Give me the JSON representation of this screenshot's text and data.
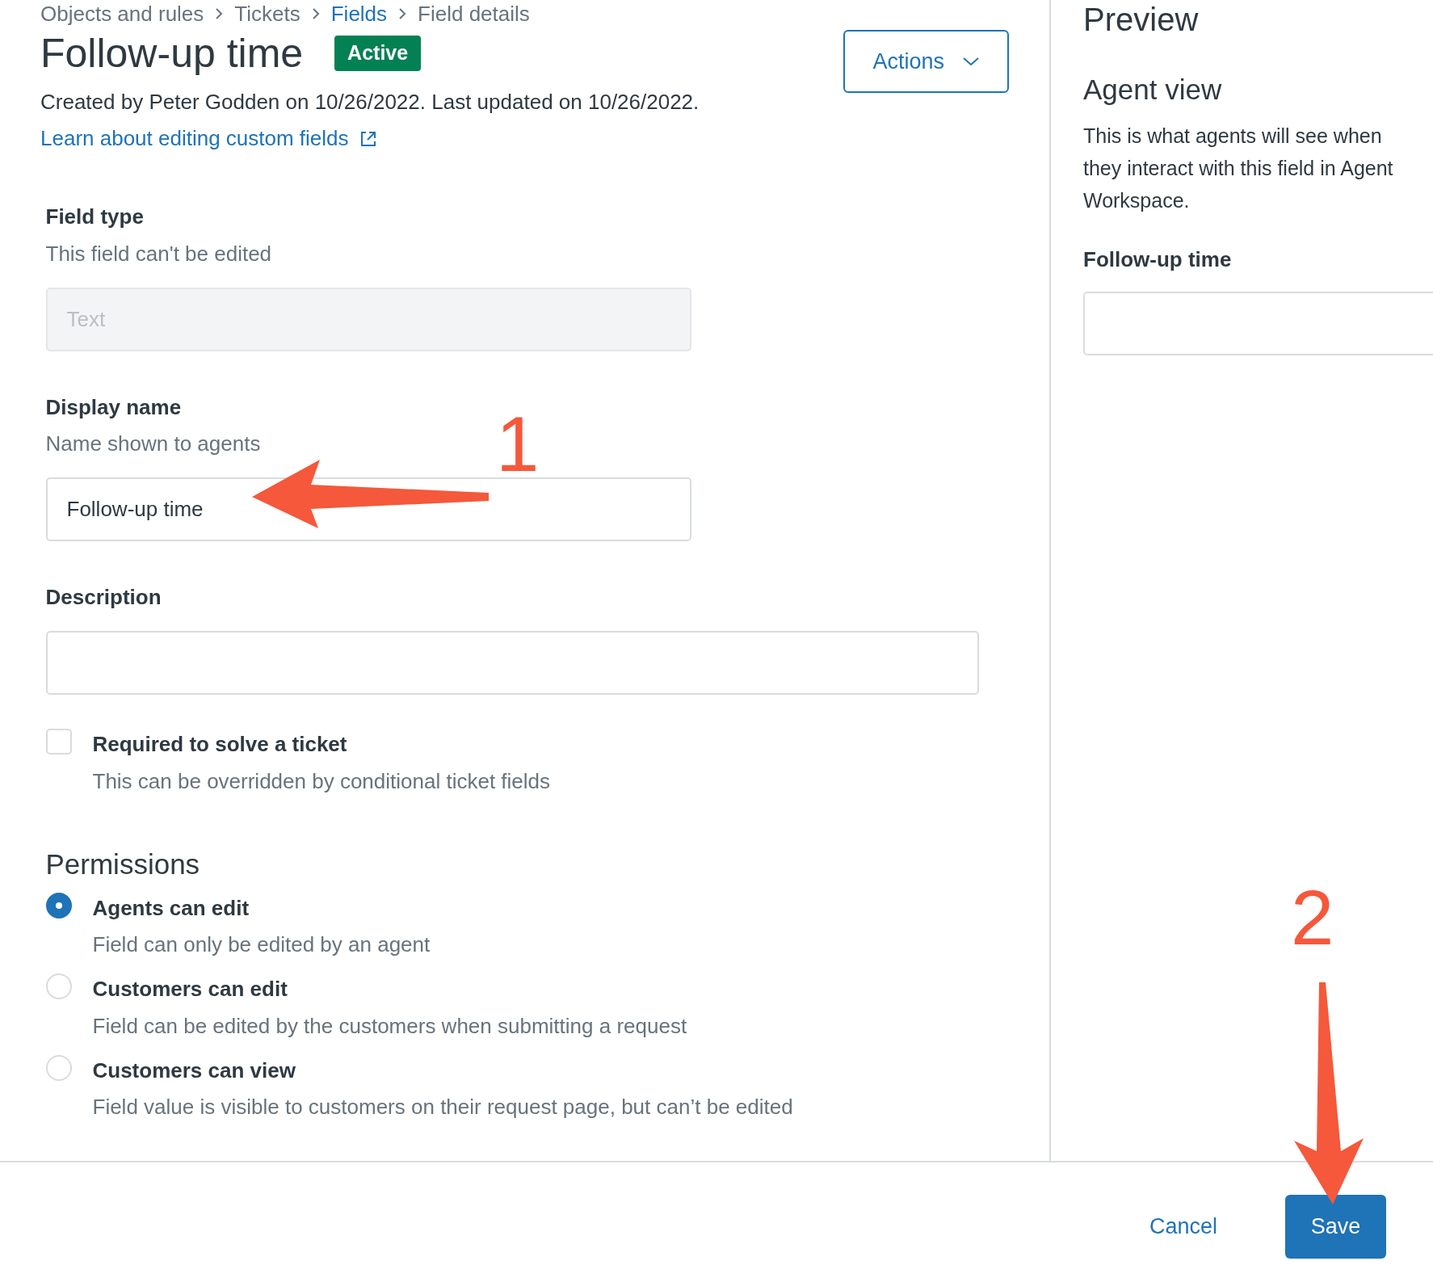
{
  "breadcrumb": [
    {
      "label": "Objects and rules",
      "link": false
    },
    {
      "label": "Tickets",
      "link": false
    },
    {
      "label": "Fields",
      "link": true
    },
    {
      "label": "Field details",
      "link": false
    }
  ],
  "title": "Follow-up time",
  "status_badge": "Active",
  "actions_button": "Actions",
  "meta": "Created by Peter Godden on 10/26/2022. Last updated on 10/26/2022.",
  "help_link": "Learn about editing custom fields",
  "fields": [
    {
      "kind": "input",
      "label": "Field type",
      "hint": "This field can't be edited",
      "value": "Text",
      "disabled": true
    },
    {
      "kind": "input",
      "label": "Display name",
      "hint": "Name shown to agents",
      "value": "Follow-up time",
      "disabled": false
    },
    {
      "kind": "textarea",
      "label": "Description",
      "disabled": false
    }
  ],
  "required": {
    "label": "Required to solve a ticket",
    "hint": "This can be overridden by conditional ticket fields",
    "checked": false
  },
  "permissions": {
    "heading": "Permissions",
    "options": [
      {
        "label": "Agents can edit",
        "hint": "Field can only be edited by an agent",
        "selected": true
      },
      {
        "label": "Customers can edit",
        "hint": "Field can be edited by the customers when submitting a request",
        "selected": false
      },
      {
        "label": "Customers can view",
        "hint": "Field value is visible to customers on their request page, but can’t be edited",
        "selected": false
      }
    ]
  },
  "preview": {
    "heading": "Preview",
    "subheading": "Agent view",
    "text": "This is what agents will see when they interact with this field in Agent Workspace.",
    "field_label": "Follow-up time"
  },
  "footer": {
    "cancel": "Cancel",
    "save": "Save"
  },
  "annotations": [
    {
      "number": "1"
    },
    {
      "number": "2"
    }
  ]
}
